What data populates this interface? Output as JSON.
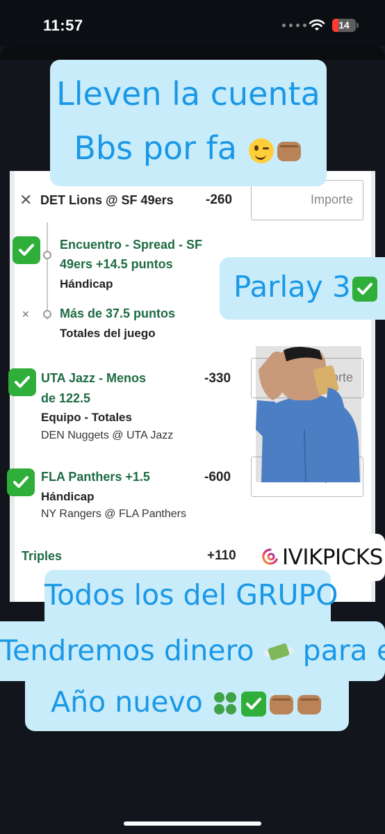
{
  "status_bar": {
    "time": "11:57",
    "battery": "14"
  },
  "story": {
    "caption_top": {
      "line1": "Lleven la cuenta",
      "line2": "Bbs por fa"
    },
    "caption_parlay": "Parlay 3",
    "caption_bottom": {
      "line1": "Todos los del GRUPO",
      "line2a": "Tendremos dinero",
      "line2b": "para el",
      "line3": "Año nuevo"
    },
    "username_tag": "IVIKPICKS"
  },
  "bet_slip": {
    "input_placeholder": "Importe",
    "bets": [
      {
        "title": "DET Lions @ SF 49ers",
        "odds": "-260",
        "legs": [
          {
            "title_line1": "Encuentro - Spread - SF",
            "title_line2": "49ers +14.5 puntos",
            "market": "Hándicap"
          },
          {
            "title": "Más de 37.5 puntos",
            "market": "Totales del juego"
          }
        ]
      },
      {
        "title_line1": "UTA Jazz - Menos",
        "title_line2": "de 122.5",
        "odds": "-330",
        "market": "Equipo - Totales",
        "event": "DEN Nuggets @ UTA Jazz"
      },
      {
        "title": "FLA Panthers +1.5",
        "odds": "-600",
        "market": "Hándicap",
        "event": "NY Rangers @ FLA Panthers"
      }
    ],
    "triples": {
      "label": "Triples",
      "odds": "+110"
    }
  },
  "colors": {
    "bubble_bg": "#c9ecfb",
    "bubble_text": "#1a98e6",
    "win_green": "#1e6b43",
    "check_green": "#2fae3a"
  }
}
